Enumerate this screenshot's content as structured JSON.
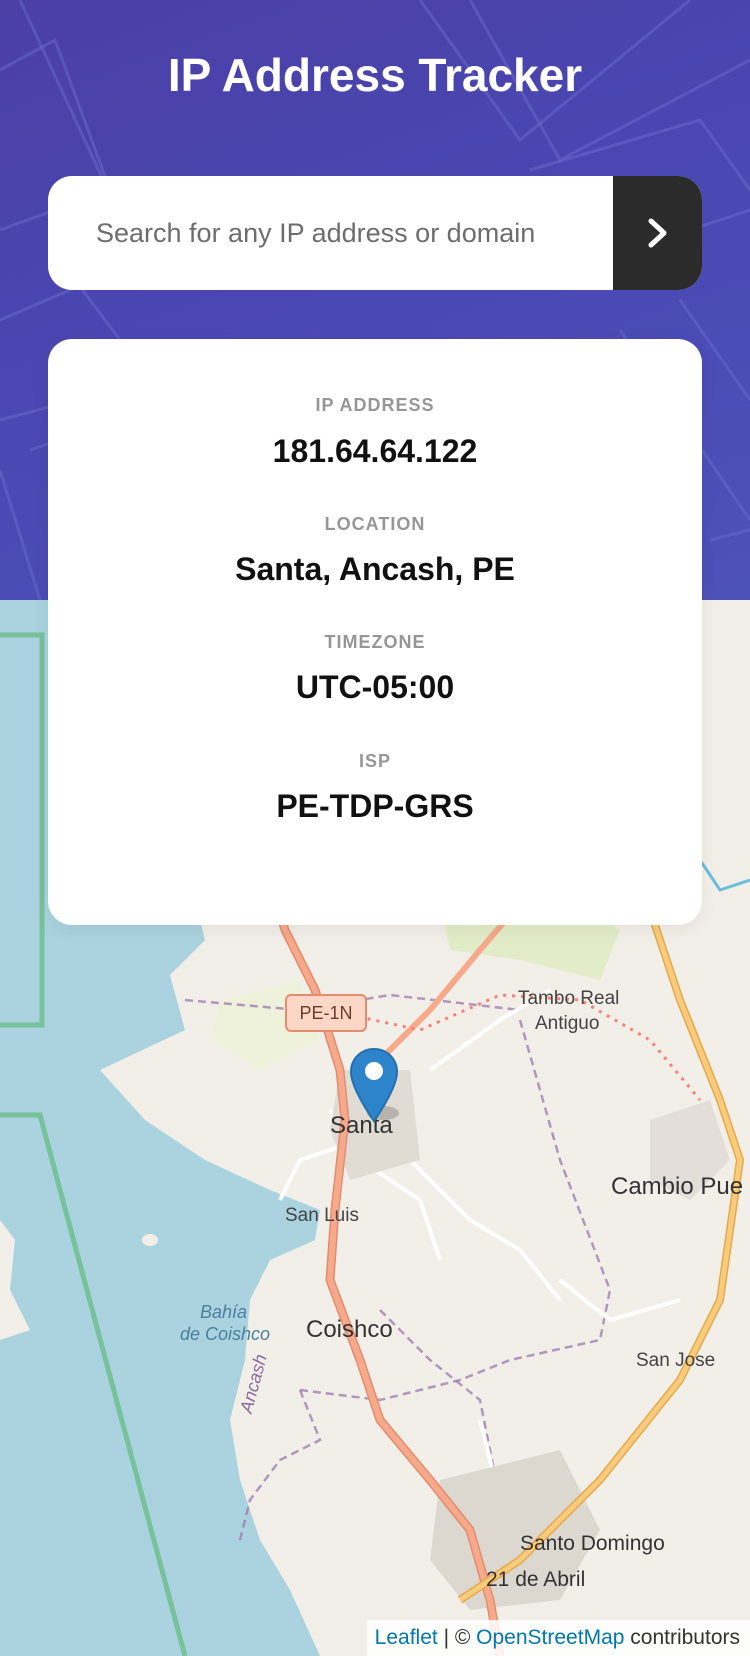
{
  "header": {
    "title": "IP Address Tracker"
  },
  "search": {
    "placeholder": "Search for any IP address or domain",
    "value": ""
  },
  "info": {
    "ip_label": "IP ADDRESS",
    "ip_value": "181.64.64.122",
    "location_label": "LOCATION",
    "location_value": "Santa, Ancash, PE",
    "timezone_label": "TIMEZONE",
    "timezone_value": "UTC-05:00",
    "isp_label": "ISP",
    "isp_value": "PE-TDP-GRS"
  },
  "map": {
    "places": {
      "santa": "Santa",
      "san_luis": "San Luis",
      "coishco": "Coishco",
      "bahia_1": "Bahía",
      "bahia_2": "de Coishco",
      "ancash": "Ancash",
      "tambo_1": "Tambo Real",
      "tambo_2": "Antiguo",
      "cambio": "Cambio Pue",
      "san_jose": "San Jose",
      "santo_domingo": "Santo Domingo",
      "abril": "21 de Abril",
      "road_shield": "PE-1N"
    },
    "attribution": {
      "leaflet": "Leaflet",
      "separator": " | © ",
      "osm": "OpenStreetMap",
      "suffix": " contributors"
    }
  },
  "colors": {
    "hero": "#4a47b2",
    "button": "#2b2b2b",
    "water": "#aad3df",
    "land": "#f2efe9",
    "road": "#f39b7c",
    "highway": "#f5c97a",
    "pin": "#2e84cb"
  },
  "icons": {
    "submit": "chevron-right-icon",
    "marker": "map-pin-icon"
  }
}
